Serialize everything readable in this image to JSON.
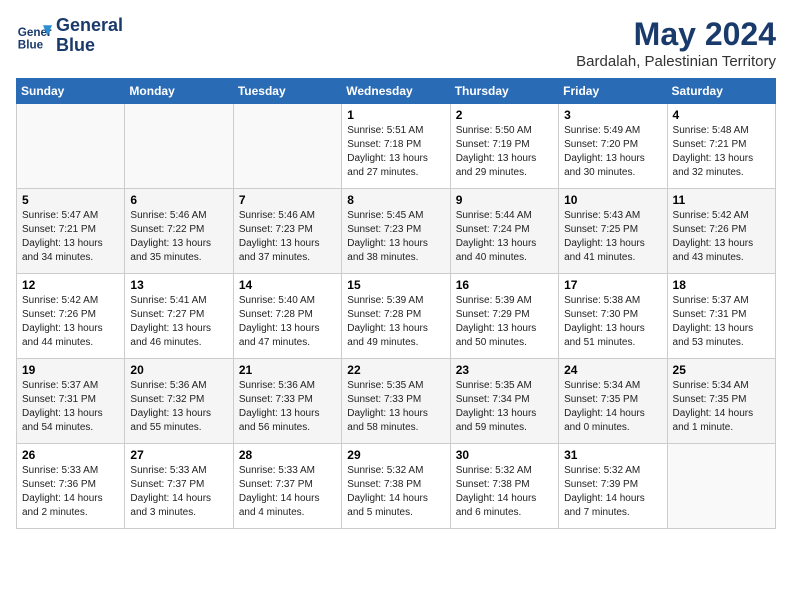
{
  "header": {
    "logo_line1": "General",
    "logo_line2": "Blue",
    "month": "May 2024",
    "location": "Bardalah, Palestinian Territory"
  },
  "weekdays": [
    "Sunday",
    "Monday",
    "Tuesday",
    "Wednesday",
    "Thursday",
    "Friday",
    "Saturday"
  ],
  "weeks": [
    [
      {
        "day": "",
        "info": ""
      },
      {
        "day": "",
        "info": ""
      },
      {
        "day": "",
        "info": ""
      },
      {
        "day": "1",
        "info": "Sunrise: 5:51 AM\nSunset: 7:18 PM\nDaylight: 13 hours\nand 27 minutes."
      },
      {
        "day": "2",
        "info": "Sunrise: 5:50 AM\nSunset: 7:19 PM\nDaylight: 13 hours\nand 29 minutes."
      },
      {
        "day": "3",
        "info": "Sunrise: 5:49 AM\nSunset: 7:20 PM\nDaylight: 13 hours\nand 30 minutes."
      },
      {
        "day": "4",
        "info": "Sunrise: 5:48 AM\nSunset: 7:21 PM\nDaylight: 13 hours\nand 32 minutes."
      }
    ],
    [
      {
        "day": "5",
        "info": "Sunrise: 5:47 AM\nSunset: 7:21 PM\nDaylight: 13 hours\nand 34 minutes."
      },
      {
        "day": "6",
        "info": "Sunrise: 5:46 AM\nSunset: 7:22 PM\nDaylight: 13 hours\nand 35 minutes."
      },
      {
        "day": "7",
        "info": "Sunrise: 5:46 AM\nSunset: 7:23 PM\nDaylight: 13 hours\nand 37 minutes."
      },
      {
        "day": "8",
        "info": "Sunrise: 5:45 AM\nSunset: 7:23 PM\nDaylight: 13 hours\nand 38 minutes."
      },
      {
        "day": "9",
        "info": "Sunrise: 5:44 AM\nSunset: 7:24 PM\nDaylight: 13 hours\nand 40 minutes."
      },
      {
        "day": "10",
        "info": "Sunrise: 5:43 AM\nSunset: 7:25 PM\nDaylight: 13 hours\nand 41 minutes."
      },
      {
        "day": "11",
        "info": "Sunrise: 5:42 AM\nSunset: 7:26 PM\nDaylight: 13 hours\nand 43 minutes."
      }
    ],
    [
      {
        "day": "12",
        "info": "Sunrise: 5:42 AM\nSunset: 7:26 PM\nDaylight: 13 hours\nand 44 minutes."
      },
      {
        "day": "13",
        "info": "Sunrise: 5:41 AM\nSunset: 7:27 PM\nDaylight: 13 hours\nand 46 minutes."
      },
      {
        "day": "14",
        "info": "Sunrise: 5:40 AM\nSunset: 7:28 PM\nDaylight: 13 hours\nand 47 minutes."
      },
      {
        "day": "15",
        "info": "Sunrise: 5:39 AM\nSunset: 7:28 PM\nDaylight: 13 hours\nand 49 minutes."
      },
      {
        "day": "16",
        "info": "Sunrise: 5:39 AM\nSunset: 7:29 PM\nDaylight: 13 hours\nand 50 minutes."
      },
      {
        "day": "17",
        "info": "Sunrise: 5:38 AM\nSunset: 7:30 PM\nDaylight: 13 hours\nand 51 minutes."
      },
      {
        "day": "18",
        "info": "Sunrise: 5:37 AM\nSunset: 7:31 PM\nDaylight: 13 hours\nand 53 minutes."
      }
    ],
    [
      {
        "day": "19",
        "info": "Sunrise: 5:37 AM\nSunset: 7:31 PM\nDaylight: 13 hours\nand 54 minutes."
      },
      {
        "day": "20",
        "info": "Sunrise: 5:36 AM\nSunset: 7:32 PM\nDaylight: 13 hours\nand 55 minutes."
      },
      {
        "day": "21",
        "info": "Sunrise: 5:36 AM\nSunset: 7:33 PM\nDaylight: 13 hours\nand 56 minutes."
      },
      {
        "day": "22",
        "info": "Sunrise: 5:35 AM\nSunset: 7:33 PM\nDaylight: 13 hours\nand 58 minutes."
      },
      {
        "day": "23",
        "info": "Sunrise: 5:35 AM\nSunset: 7:34 PM\nDaylight: 13 hours\nand 59 minutes."
      },
      {
        "day": "24",
        "info": "Sunrise: 5:34 AM\nSunset: 7:35 PM\nDaylight: 14 hours\nand 0 minutes."
      },
      {
        "day": "25",
        "info": "Sunrise: 5:34 AM\nSunset: 7:35 PM\nDaylight: 14 hours\nand 1 minute."
      }
    ],
    [
      {
        "day": "26",
        "info": "Sunrise: 5:33 AM\nSunset: 7:36 PM\nDaylight: 14 hours\nand 2 minutes."
      },
      {
        "day": "27",
        "info": "Sunrise: 5:33 AM\nSunset: 7:37 PM\nDaylight: 14 hours\nand 3 minutes."
      },
      {
        "day": "28",
        "info": "Sunrise: 5:33 AM\nSunset: 7:37 PM\nDaylight: 14 hours\nand 4 minutes."
      },
      {
        "day": "29",
        "info": "Sunrise: 5:32 AM\nSunset: 7:38 PM\nDaylight: 14 hours\nand 5 minutes."
      },
      {
        "day": "30",
        "info": "Sunrise: 5:32 AM\nSunset: 7:38 PM\nDaylight: 14 hours\nand 6 minutes."
      },
      {
        "day": "31",
        "info": "Sunrise: 5:32 AM\nSunset: 7:39 PM\nDaylight: 14 hours\nand 7 minutes."
      },
      {
        "day": "",
        "info": ""
      }
    ]
  ]
}
